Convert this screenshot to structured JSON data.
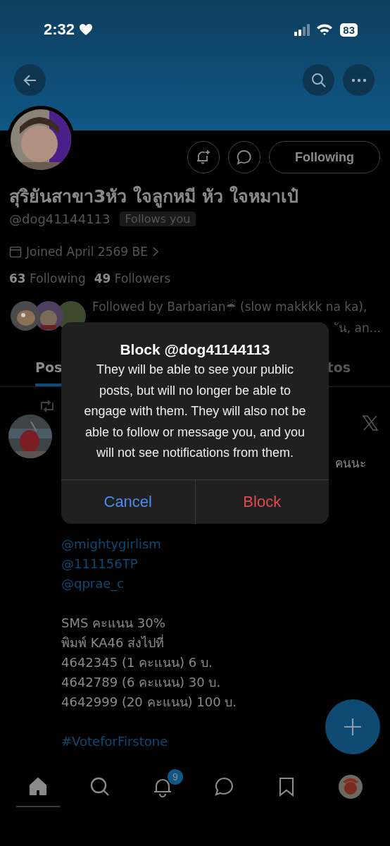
{
  "status_bar": {
    "time": "2:32",
    "battery": "83"
  },
  "profile": {
    "follow_button": "Following",
    "name": "สุริยันสาขา3หัว ใจลูกหมี หัว ใจหมาเป๋",
    "handle": "@dog41144113",
    "follows_you": "Follows you",
    "joined": "Joined April 2569 BE",
    "following_count": "63",
    "following_label": "Following",
    "followers_count": "49",
    "followers_label": "Followers",
    "followed_by": "Followed by Barbarian☔ (slow makkkk na ka),",
    "followed_by_rest": "ัน, an..."
  },
  "tabs": [
    {
      "label": "Pos",
      "selected": true
    },
    {
      "label": "tos",
      "selected": false
    }
  ],
  "post": {
    "side_text": "คนนะ",
    "lines": [
      {
        "kind": "link",
        "text": "@mightygirlism"
      },
      {
        "kind": "link",
        "text": "@111156TP"
      },
      {
        "kind": "link",
        "text": "@qprae_c"
      },
      {
        "kind": "gap"
      },
      {
        "kind": "text",
        "text": "SMS คะแนน 30%"
      },
      {
        "kind": "text",
        "text": "พิมพ์ KA46 ส่งไปที่"
      },
      {
        "kind": "text",
        "text": "4642345 (1 คะแนน) 6 บ."
      },
      {
        "kind": "text",
        "text": "4642789 (6 คะแนน) 30 บ."
      },
      {
        "kind": "text",
        "text": "4642999 (20 คะแนน) 100 บ."
      },
      {
        "kind": "gap"
      },
      {
        "kind": "link",
        "text": "#VoteforFirstone"
      }
    ]
  },
  "dialog": {
    "title": "Block @dog41144113",
    "message": "They will be able to see your public posts, but will no longer be able to engage with them. They will also not be able to follow or message you, and you will not see notifications from them.",
    "buttons": [
      {
        "label": "Cancel",
        "kind": "cancel"
      },
      {
        "label": "Block",
        "kind": "destructive"
      }
    ]
  },
  "tab_bar": [
    {
      "kind": "home",
      "selected": true
    },
    {
      "kind": "search",
      "selected": false
    },
    {
      "kind": "notifications",
      "selected": false,
      "badge": "9"
    },
    {
      "kind": "messages",
      "selected": false
    },
    {
      "kind": "bookmarks",
      "selected": false
    },
    {
      "kind": "profile",
      "selected": false
    }
  ]
}
